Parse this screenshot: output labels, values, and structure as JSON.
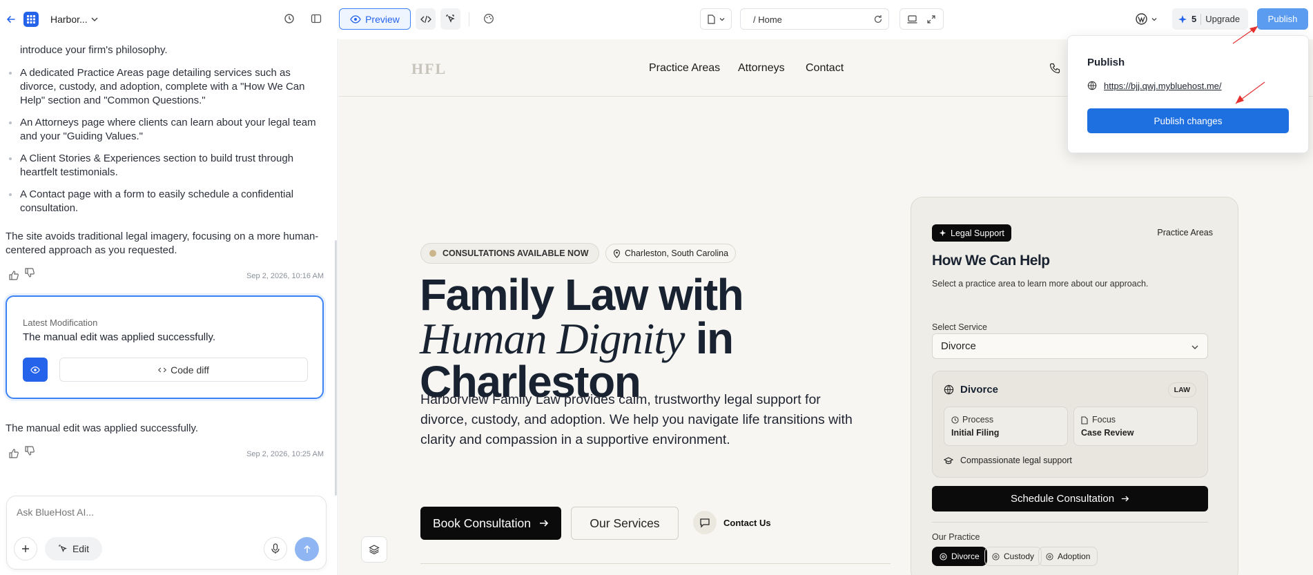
{
  "topbar": {
    "project_name": "Harbor...",
    "preview_label": "Preview",
    "path": "/ Home",
    "credits": "5",
    "upgrade_label": "Upgrade",
    "publish_label": "Publish"
  },
  "chat": {
    "partial_line": "introduce your firm's philosophy.",
    "bullets": [
      "A dedicated Practice Areas page detailing services such as divorce, custody, and adoption, complete with a \"How We Can Help\" section and \"Common Questions.\"",
      "An Attorneys page where clients can learn about your legal team and your \"Guiding Values.\"",
      "A Client Stories & Experiences section to build trust through heartfelt testimonials.",
      "A Contact page with a form to easily schedule a confidential consultation."
    ],
    "summary": "The site avoids traditional legal imagery, focusing on a more human-centered approach as you requested.",
    "timestamp1": "Sep 2, 2026, 10:16 AM",
    "mod_card": {
      "label": "Latest Modification",
      "text": "The manual edit was applied successfully.",
      "code_diff": "Code diff"
    },
    "message2": "The manual edit was applied successfully.",
    "timestamp2": "Sep 2, 2026, 10:25 AM",
    "input_placeholder": "Ask BlueHost AI...",
    "edit_label": "Edit"
  },
  "site": {
    "logo": "HFL",
    "nav": [
      "Practice Areas",
      "Attorneys",
      "Contact"
    ],
    "badge_consult": "CONSULTATIONS AVAILABLE NOW",
    "badge_location": "Charleston, South Carolina",
    "hero_line1": "Family Law with",
    "hero_italic": "Human Dignity",
    "hero_in": "in",
    "hero_line3": "Charleston",
    "hero_desc": "Harborview Family Law provides calm, trustworthy legal support for divorce, custody, and adoption. We help you navigate life transitions with clarity and compassion in a supportive environment.",
    "btn_book": "Book Consultation",
    "btn_services": "Our Services",
    "btn_contact": "Contact Us",
    "card": {
      "tag": "Legal Support",
      "tag_right": "Practice Areas",
      "title": "How We Can Help",
      "subtitle": "Select a practice area to learn more about our approach.",
      "select_label": "Select Service",
      "select_value": "Divorce",
      "inner_title": "Divorce",
      "inner_badge": "LAW",
      "process_label": "Process",
      "process_value": "Initial Filing",
      "focus_label": "Focus",
      "focus_value": "Case Review",
      "support_text": "Compassionate legal support",
      "schedule_btn": "Schedule Consultation",
      "our_practice": "Our Practice",
      "chips": [
        "Divorce",
        "Custody",
        "Adoption"
      ]
    }
  },
  "popover": {
    "title": "Publish",
    "url": "https://bjj.qwj.mybluehost.me/",
    "button": "Publish changes"
  }
}
